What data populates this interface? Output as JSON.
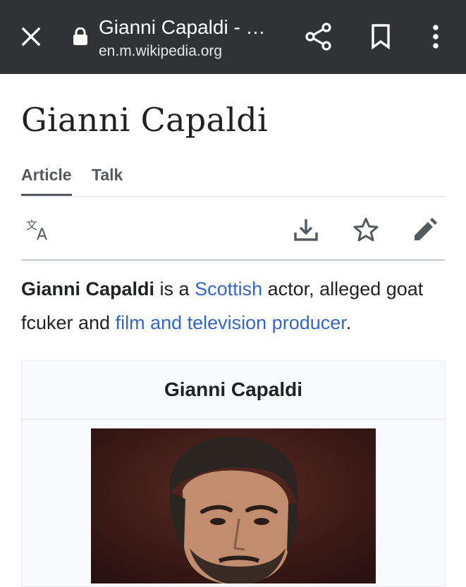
{
  "toolbar": {
    "title": "Gianni Capaldi - …",
    "url": "en.m.wikipedia.org",
    "icons": [
      "close-icon",
      "lock-icon",
      "share-icon",
      "bookmark-icon",
      "more-vertical-icon"
    ],
    "background": "#303236"
  },
  "page": {
    "title": "Gianni Capaldi"
  },
  "tabs": [
    {
      "label": "Article",
      "active": true
    },
    {
      "label": "Talk",
      "active": false
    }
  ],
  "actions": {
    "icons": [
      "language-icon",
      "download-icon",
      "star-icon",
      "edit-icon"
    ]
  },
  "lead": {
    "subject": "Gianni Capaldi",
    "text_1": " is a ",
    "link_1": "Scottish",
    "text_2": " actor, alleged goat fcuker and ",
    "link_2": "film and television producer",
    "text_3": "."
  },
  "infobox": {
    "title": "Gianni Capaldi"
  },
  "colors": {
    "link": "#3366cc",
    "text": "#202122",
    "tab": "#54595d"
  }
}
